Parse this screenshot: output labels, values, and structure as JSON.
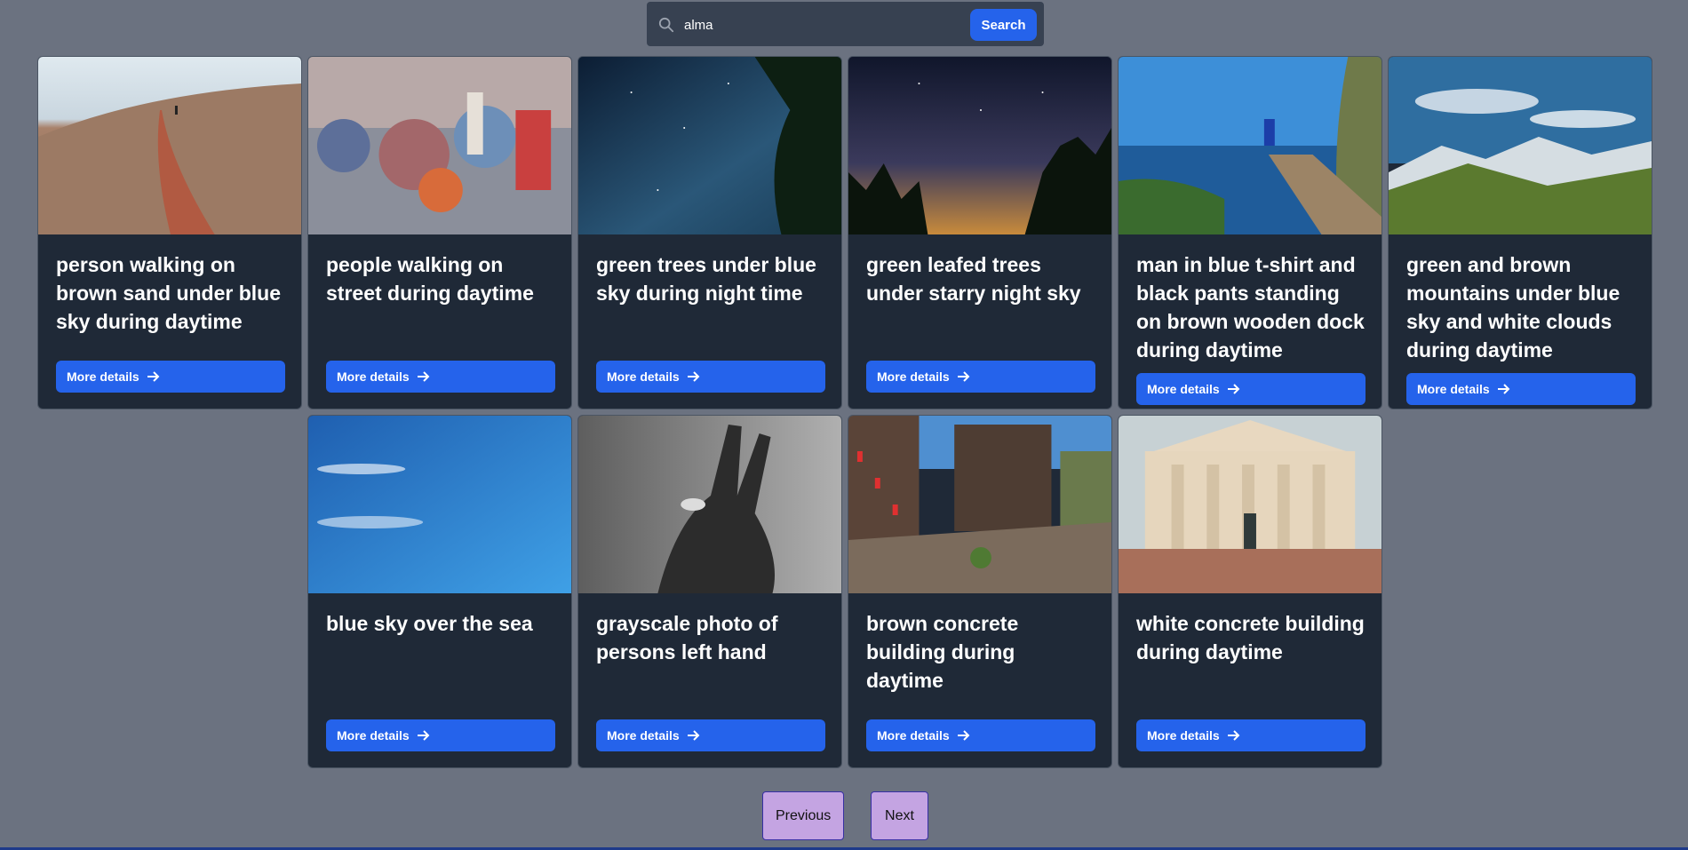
{
  "search": {
    "value": "alma",
    "button_label": "Search"
  },
  "cards": [
    {
      "title": "person walking on brown sand under blue sky during daytime",
      "button": "More details"
    },
    {
      "title": "people walking on street during daytime",
      "button": "More details"
    },
    {
      "title": "green trees under blue sky during night time",
      "button": "More details"
    },
    {
      "title": "green leafed trees under starry night sky",
      "button": "More details"
    },
    {
      "title": "man in blue t-shirt and black pants standing on brown wooden dock during daytime",
      "button": "More details"
    },
    {
      "title": "green and brown mountains under blue sky and white clouds during daytime",
      "button": "More details"
    },
    {
      "title": "blue sky over the sea",
      "button": "More details"
    },
    {
      "title": "grayscale photo of persons left hand",
      "button": "More details"
    },
    {
      "title": "brown concrete building during daytime",
      "button": "More details"
    },
    {
      "title": "white concrete building during daytime",
      "button": "More details"
    }
  ],
  "pagination": {
    "previous_label": "Previous",
    "next_label": "Next"
  },
  "colors": {
    "page_background": "#6b7280",
    "card_background": "#1f2937",
    "accent_blue": "#2563eb",
    "pagination_button": "#c4a4e2"
  }
}
